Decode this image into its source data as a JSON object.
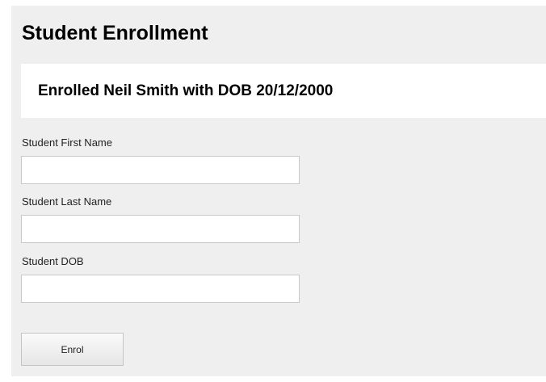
{
  "page": {
    "title": "Student Enrollment"
  },
  "message": {
    "text": "Enrolled Neil Smith with DOB 20/12/2000"
  },
  "form": {
    "first_name": {
      "label": "Student First Name",
      "value": ""
    },
    "last_name": {
      "label": "Student Last Name",
      "value": ""
    },
    "dob": {
      "label": "Student DOB",
      "value": ""
    },
    "submit_label": "Enrol"
  }
}
